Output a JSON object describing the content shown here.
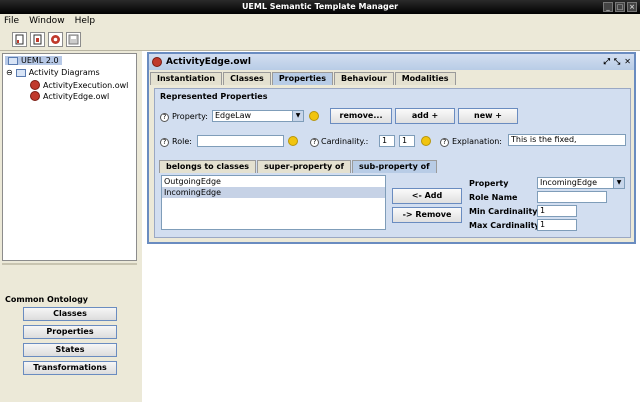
{
  "window": {
    "title": "UEML Semantic Template Manager"
  },
  "menu": {
    "file": "File",
    "window": "Window",
    "help": "Help"
  },
  "tree": {
    "root": "UEML 2.0",
    "folder": "Activity Diagrams",
    "items": [
      "ActivityExecution.owl",
      "ActivityEdge.owl"
    ]
  },
  "ontology": {
    "title": "Common Ontology",
    "buttons": [
      "Classes",
      "Properties",
      "States",
      "Transformations"
    ]
  },
  "editor": {
    "title": "ActivityEdge.owl",
    "tabs": [
      "Instantiation",
      "Classes",
      "Properties",
      "Behaviour",
      "Modalities"
    ],
    "active_tab": "Properties",
    "section_title": "Represented Properties",
    "property_label": "Property:",
    "property_value": "EdgeLaw",
    "remove_button": "remove...",
    "add_button": "add +",
    "new_button": "new +",
    "role_label": "Role:",
    "role_value": "",
    "cardinality_label": "Cardinality.:",
    "card_min": "1",
    "card_max": "1",
    "explanation_label": "Explanation:",
    "explanation_value": "This is the fixed,",
    "subtabs": [
      "belongs to classes",
      "super-property of",
      "sub-property of"
    ],
    "active_subtab": "sub-property of",
    "list_items": [
      "OutgoingEdge",
      "IncomingEdge"
    ],
    "selected_item": "IncomingEdge",
    "list_add_button": "<- Add",
    "list_remove_button": "-> Remove",
    "detail": {
      "property_label": "Property",
      "property_value": "IncomingEdge",
      "role_name_label": "Role Name",
      "role_name_value": "",
      "min_card_label": "Min Cardinality",
      "min_card_value": "1",
      "max_card_label": "Max Cardinality",
      "max_card_value": "1"
    }
  },
  "colors": {
    "titlebar": "#000000",
    "frame_border": "#6a8cc0",
    "panel_bg": "#d2def0",
    "active_tab": "#b8cce6",
    "owl_icon": "#c0392b"
  }
}
